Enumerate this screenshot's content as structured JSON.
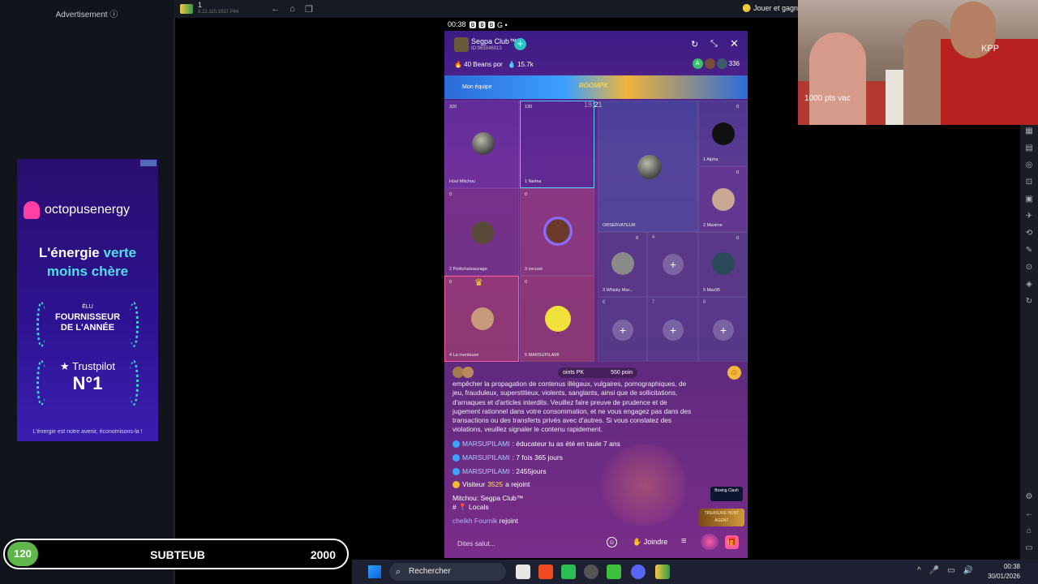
{
  "ad": {
    "label": "Advertisement",
    "brand": "octopusenergy",
    "headline_1": "L'énergie",
    "headline_2": "verte",
    "headline_3": "moins chère",
    "award_small": "ÉLU",
    "award_line_1": "FOURNISSEUR",
    "award_line_2": "DE L'ANNÉE",
    "trustpilot": "★ Trustpilot",
    "rank": "N°1",
    "footer": "L'énergie est notre avenir, économisons-la !"
  },
  "emulator": {
    "tab_title": "1",
    "tab_sub": "8.22.110.1037 P64",
    "right_text": "Jouer et gagn"
  },
  "status_bar": {
    "time": "00:38",
    "icons": "🅱 🅱 🅱 G •"
  },
  "room": {
    "name": "Segpa Club™",
    "id": "ID:969346013",
    "beans": "🔥 40 Beans por",
    "diamonds": "💧 15.7k",
    "viewer_badge": "A",
    "viewer_count": "336",
    "banner_left": "Mon équipe",
    "banner_mid": "ROOMPK",
    "timer": "18:21"
  },
  "seats": [
    {
      "score": "320",
      "name": "Host  Mitchou"
    },
    {
      "score": "130",
      "name": "1  Naima"
    },
    {
      "score": "",
      "name": "OBSERVATEUR"
    },
    {
      "score": "0",
      "name": "1  Alpha"
    },
    {
      "score": "0",
      "name": "2  Petitchatsauvage"
    },
    {
      "score": "0",
      "name": "3  excusé"
    },
    {
      "score": "0",
      "name": "2  Maxime"
    },
    {
      "score": "0",
      "name": "3  Whisky Mar..."
    },
    {
      "score": "0",
      "name": "5  Max95"
    },
    {
      "score": "0",
      "name": "4  La menteuse"
    },
    {
      "score": "0",
      "name": "5  MARSUPILAMI"
    }
  ],
  "empty_seats": [
    "4",
    "6",
    "7",
    "8"
  ],
  "pk": {
    "left": "oints PK",
    "right": "550 poin"
  },
  "chat": {
    "notice": "empêcher la propagation de contenus illégaux, vulgaires, pornographiques, de jeu, frauduleux, superstitieux, violents, sanglants, ainsi que de sollicitations, d'arnaques et d'articles interdits. Veuillez faire preuve de prudence et de jugement rationnel dans votre consommation, et ne vous engagez pas dans des transactions ou des transferts privés avec d'autres. Si vous constatez des violations, veuillez signaler le contenu rapidement.",
    "messages": [
      {
        "nick": "MARSUPILAMI",
        "text": " : éducateur tu as été en taule 7 ans"
      },
      {
        "nick": "MARSUPILAMI",
        "text": " : 7 fois 365 jours"
      },
      {
        "nick": "MARSUPILAMI",
        "text": " : 2455jours"
      }
    ],
    "visitor_pre": "Visiteur",
    "visitor_num": "3525",
    "visitor_post": "a rejoint",
    "pinned": "Mitchou: Segpa Club™",
    "locals": "# 📍 Locals",
    "joined_nick": "cheikh Fournik",
    "joined_text": "rejoint",
    "game1": "Boxing Clash",
    "game2": "TREASURE HUNT AGENT"
  },
  "input": {
    "placeholder": "Dites salut...",
    "join_label": "✋ Joindre"
  },
  "webcam": {
    "shirt_text": "1000 pts vac",
    "shirt_text_2": "KPP"
  },
  "overlay": {
    "count": "120",
    "label": "SUBTEUB",
    "target": "2000"
  },
  "taskbar": {
    "search": "Rechercher",
    "time": "00:38",
    "date": "30/01/2026"
  }
}
